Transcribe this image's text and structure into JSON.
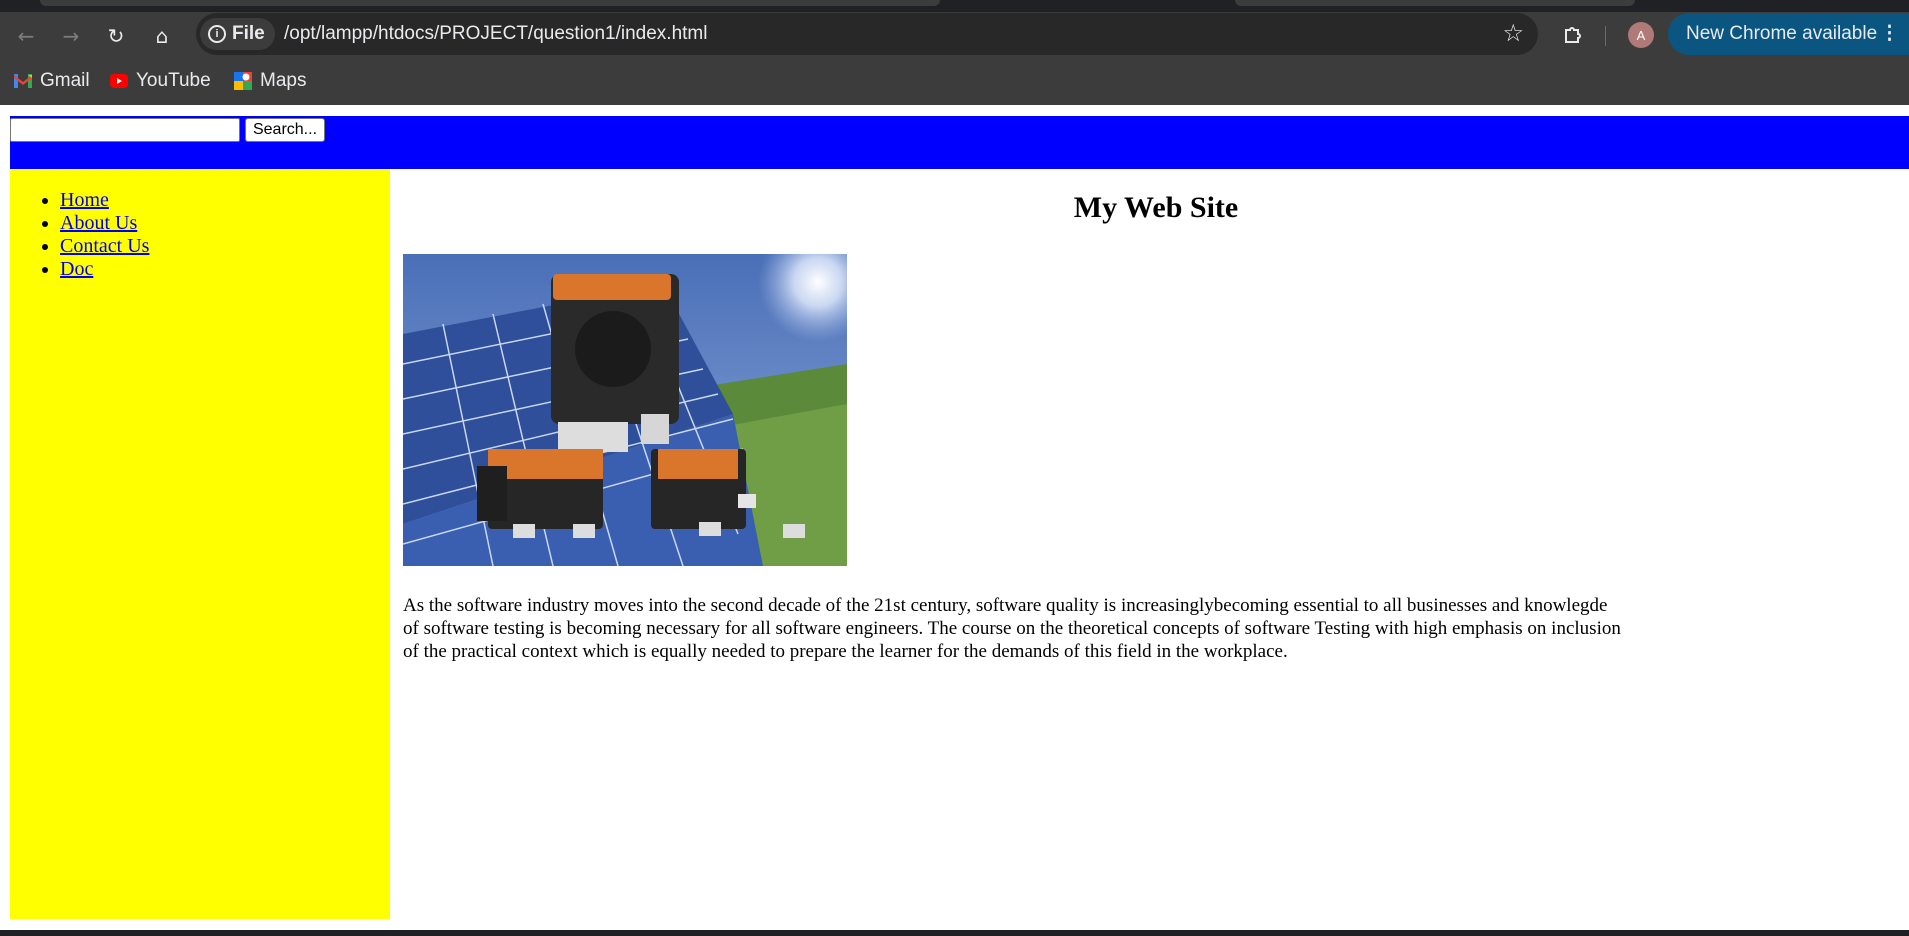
{
  "browser": {
    "chip_label": "File",
    "url": "/opt/lampp/htdocs/PROJECT/question1/index.html",
    "update_label": "New Chrome available",
    "profile_initial": "A",
    "bookmarks": [
      {
        "label": "Gmail",
        "icon": "gmail-icon"
      },
      {
        "label": "YouTube",
        "icon": "youtube-icon"
      },
      {
        "label": "Maps",
        "icon": "maps-icon"
      }
    ]
  },
  "page": {
    "search_button": "Search...",
    "search_value": "",
    "nav": [
      {
        "label": "Home"
      },
      {
        "label": "About Us"
      },
      {
        "label": "Contact Us"
      },
      {
        "label": "Doc"
      }
    ],
    "title": "My Web Site",
    "paragraph": "As the software industry moves into the second decade of the 21st century, software quality is increasinglybecoming essential to all businesses and knowlegde of software testing is becoming necessary for all software engineers. The course on the theoretical concepts of software Testing with high emphasis on inclusion of the practical context which is equally needed to prepare the learner for the demands of this field in the workplace."
  },
  "colors": {
    "header_bg": "#0000ff",
    "sidebar_bg": "#ffff00",
    "link": "#0000ee"
  }
}
